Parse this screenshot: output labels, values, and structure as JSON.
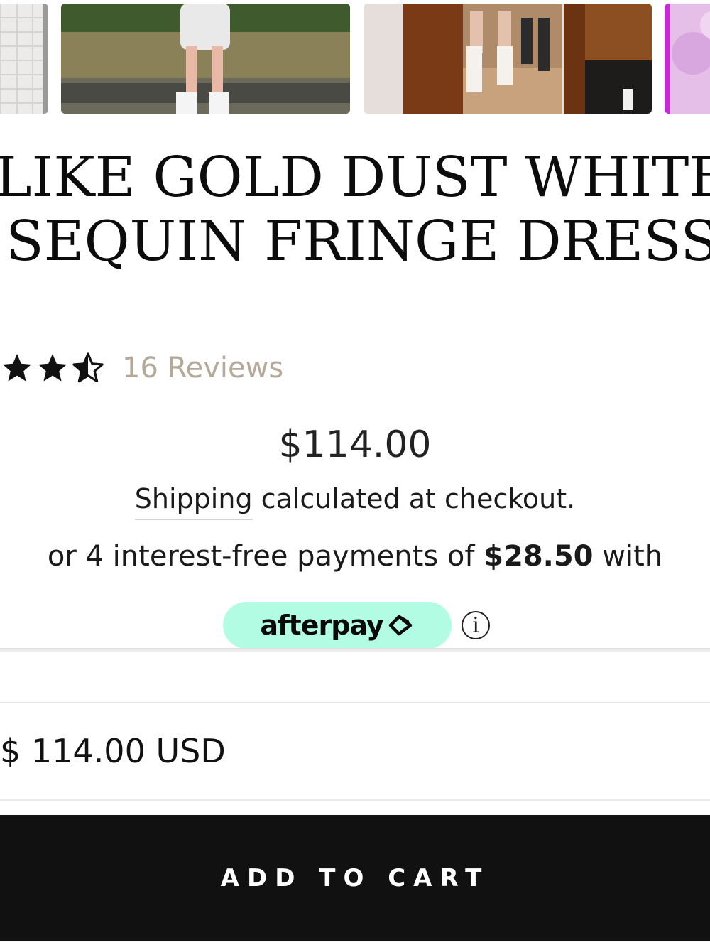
{
  "thumbnails": [
    {
      "alt": ""
    },
    {
      "alt": ""
    },
    {
      "alt": ""
    },
    {
      "alt": ""
    }
  ],
  "product": {
    "title_line1": "LIKE GOLD DUST WHITE",
    "title_line2": "SEQUIN FRINGE DRESS",
    "rating": 3.5,
    "rating_max": 5,
    "reviews_label": "16 Reviews",
    "price": "$114.00",
    "shipping_link": "Shipping",
    "shipping_rest": "calculated at checkout."
  },
  "installments": {
    "prefix": "or 4 interest-free payments of",
    "amount": "$28.50",
    "suffix": "with",
    "provider": "afterpay",
    "info_icon": "i"
  },
  "total": {
    "value": "$ 114.00 USD"
  },
  "cart": {
    "button_label": "ADD TO CART"
  },
  "colors": {
    "afterpay_mint": "#b2fce4",
    "reviews_text": "#b5a99a",
    "button_bg": "#111111"
  }
}
